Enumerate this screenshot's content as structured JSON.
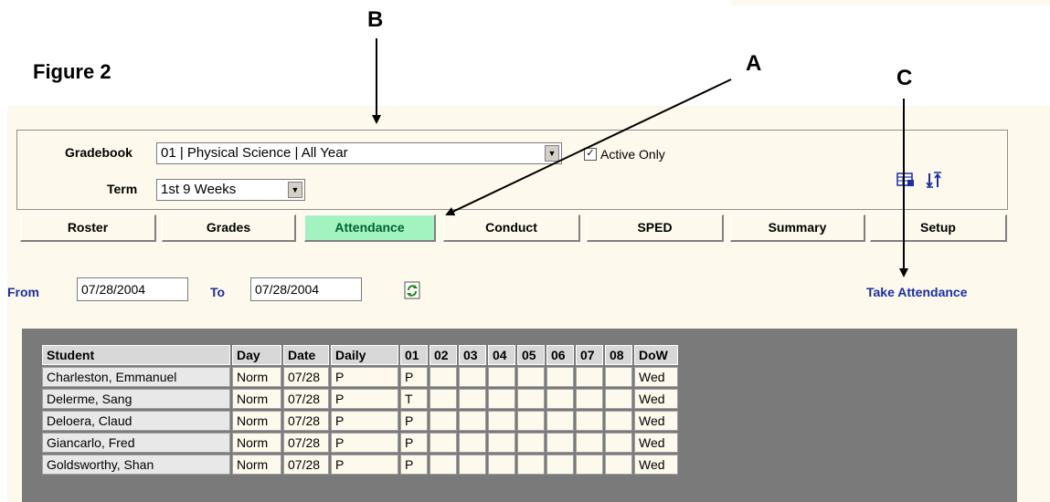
{
  "figure": {
    "title": "Figure 2"
  },
  "callouts": {
    "a": "A",
    "b": "B",
    "c": "C"
  },
  "filters": {
    "gradebook_label": "Gradebook",
    "gradebook_value": "01 | Physical Science | All Year",
    "term_label": "Term",
    "term_value": "1st 9 Weeks",
    "active_only_label": "Active Only",
    "active_only_checked": true
  },
  "tabs": [
    "Roster",
    "Grades",
    "Attendance",
    "Conduct",
    "SPED",
    "Summary",
    "Setup"
  ],
  "active_tab": "Attendance",
  "date_range": {
    "from_label": "From",
    "from_value": "07/28/2004",
    "to_label": "To",
    "to_value": "07/28/2004"
  },
  "take_attendance_label": "Take Attendance",
  "table": {
    "headers": [
      "Student",
      "Day",
      "Date",
      "Daily",
      "01",
      "02",
      "03",
      "04",
      "05",
      "06",
      "07",
      "08",
      "DoW"
    ],
    "rows": [
      [
        "Charleston, Emmanuel",
        "Norm",
        "07/28",
        "P",
        "P",
        "",
        "",
        "",
        "",
        "",
        "",
        "",
        "Wed"
      ],
      [
        "Delerme, Sang",
        "Norm",
        "07/28",
        "P",
        "T",
        "",
        "",
        "",
        "",
        "",
        "",
        "",
        "Wed"
      ],
      [
        "Deloera, Claud",
        "Norm",
        "07/28",
        "P",
        "P",
        "",
        "",
        "",
        "",
        "",
        "",
        "",
        "Wed"
      ],
      [
        "Giancarlo, Fred",
        "Norm",
        "07/28",
        "P",
        "P",
        "",
        "",
        "",
        "",
        "",
        "",
        "",
        "Wed"
      ],
      [
        "Goldsworthy, Shan",
        "Norm",
        "07/28",
        "P",
        "P",
        "",
        "",
        "",
        "",
        "",
        "",
        "",
        "Wed"
      ]
    ]
  },
  "colors": {
    "background": "#fdf9ec",
    "active_tab": "#a3f3c1",
    "link": "#1a2ea8",
    "grid_panel": "#7a7a7a"
  },
  "icons": [
    "refresh-icon",
    "export-icon",
    "sort-icon",
    "dropdown-arrow-icon",
    "checkmark-icon"
  ]
}
